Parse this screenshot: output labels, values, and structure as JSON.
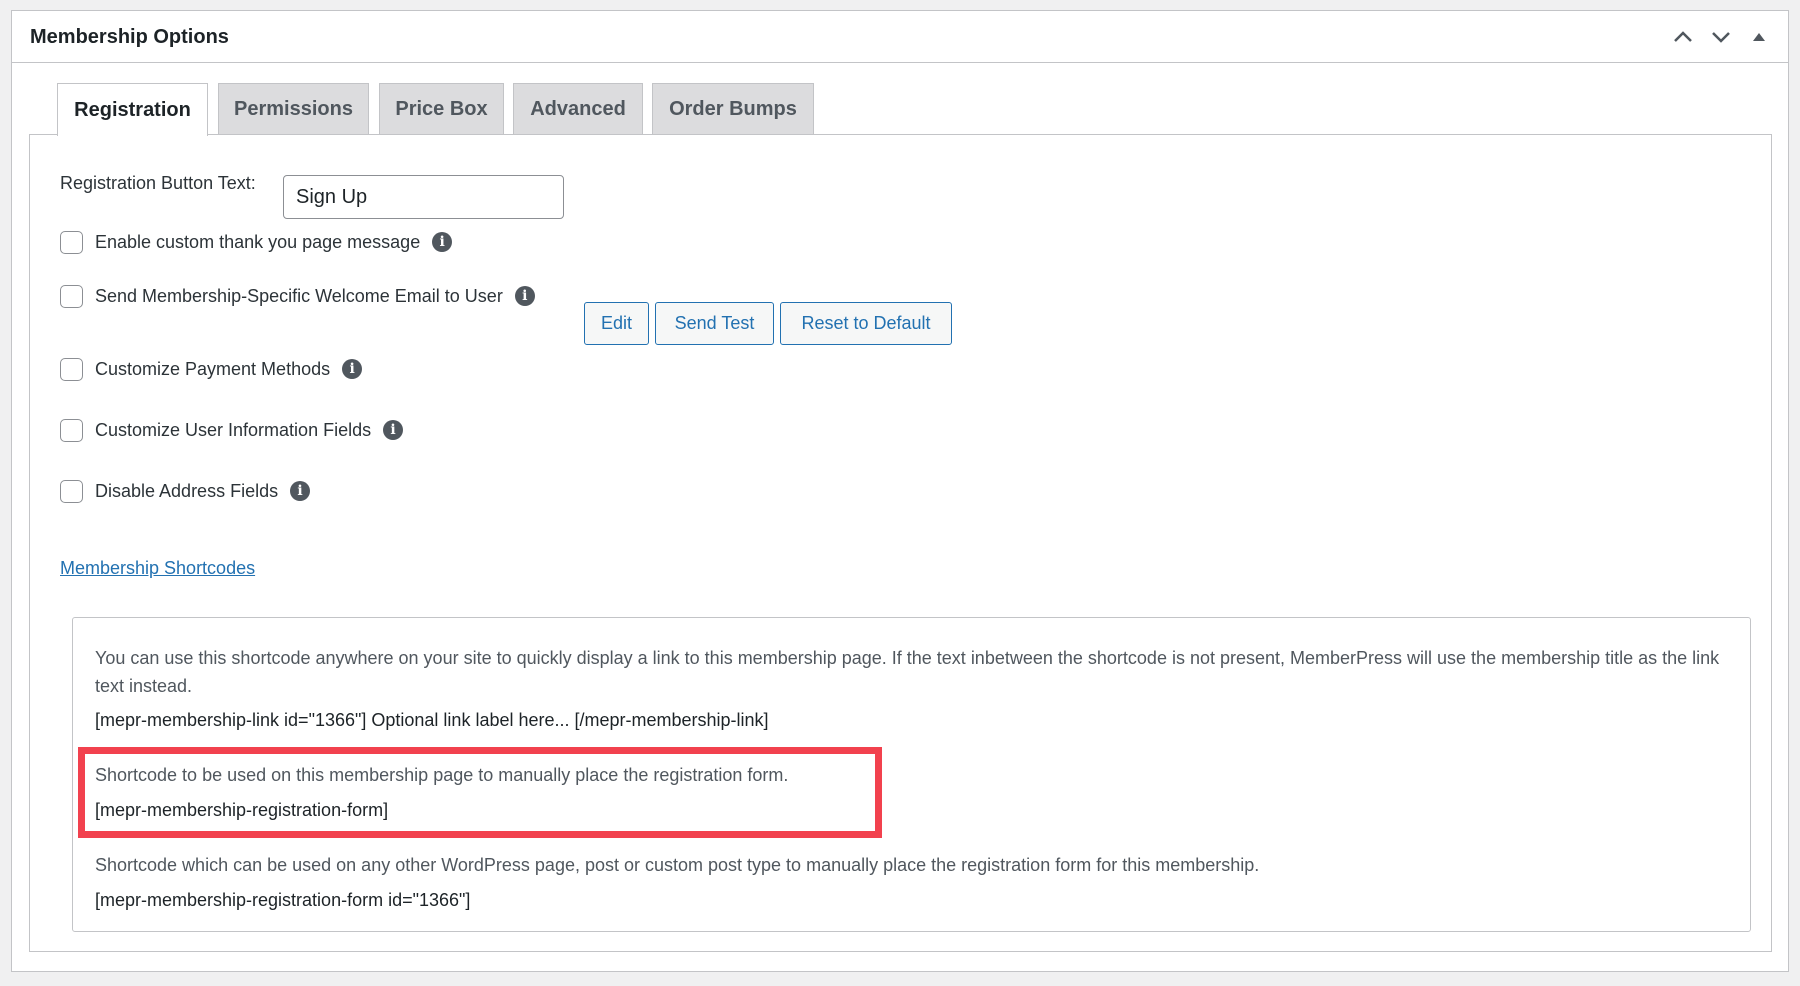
{
  "panel": {
    "title": "Membership Options",
    "actions": [
      {
        "name": "move-up",
        "icon": "chevron-up-icon"
      },
      {
        "name": "move-down",
        "icon": "chevron-down-icon"
      },
      {
        "name": "toggle-panel",
        "icon": "triangle-up-icon"
      }
    ]
  },
  "tabs": [
    {
      "label": "Registration",
      "active": true
    },
    {
      "label": "Permissions",
      "active": false
    },
    {
      "label": "Price Box",
      "active": false
    },
    {
      "label": "Advanced",
      "active": false
    },
    {
      "label": "Order Bumps",
      "active": false
    }
  ],
  "registration": {
    "button_text_label": "Registration Button Text:",
    "button_text_value": "Sign Up",
    "options": [
      {
        "label": "Enable custom thank you page message",
        "checked": false,
        "info_icon": "info-icon"
      },
      {
        "label": "Send Membership-Specific Welcome Email to User",
        "checked": false,
        "info_icon": "info-icon"
      },
      {
        "label": "Customize Payment Methods",
        "checked": false,
        "info_icon": "info-icon"
      },
      {
        "label": "Customize User Information Fields",
        "checked": false,
        "info_icon": "info-icon"
      },
      {
        "label": "Disable Address Fields",
        "checked": false,
        "info_icon": "info-icon"
      }
    ],
    "email_buttons": {
      "edit": "Edit",
      "send_test": "Send Test",
      "reset": "Reset to Default"
    },
    "shortcodes_link": "Membership Shortcodes",
    "shortcodes": {
      "link_desc": "You can use this shortcode anywhere on your site to quickly display a link to this membership page. If the text inbetween the shortcode is not present, MemberPress will use the membership title as the link text instead.",
      "link_code": "[mepr-membership-link id=\"1366\"] Optional link label here... [/mepr-membership-link]",
      "page_form_desc": "Shortcode to be used on this membership page to manually place the registration form.",
      "page_form_code": "[mepr-membership-registration-form]",
      "other_form_desc": "Shortcode which can be used on any other WordPress page, post or custom post type to manually place the registration form for this membership.",
      "other_form_code": "[mepr-membership-registration-form id=\"1366\"]"
    }
  },
  "colors": {
    "accent": "#2271b1",
    "highlight": "#f2414e",
    "tab_inactive_bg": "#dcdcde"
  }
}
